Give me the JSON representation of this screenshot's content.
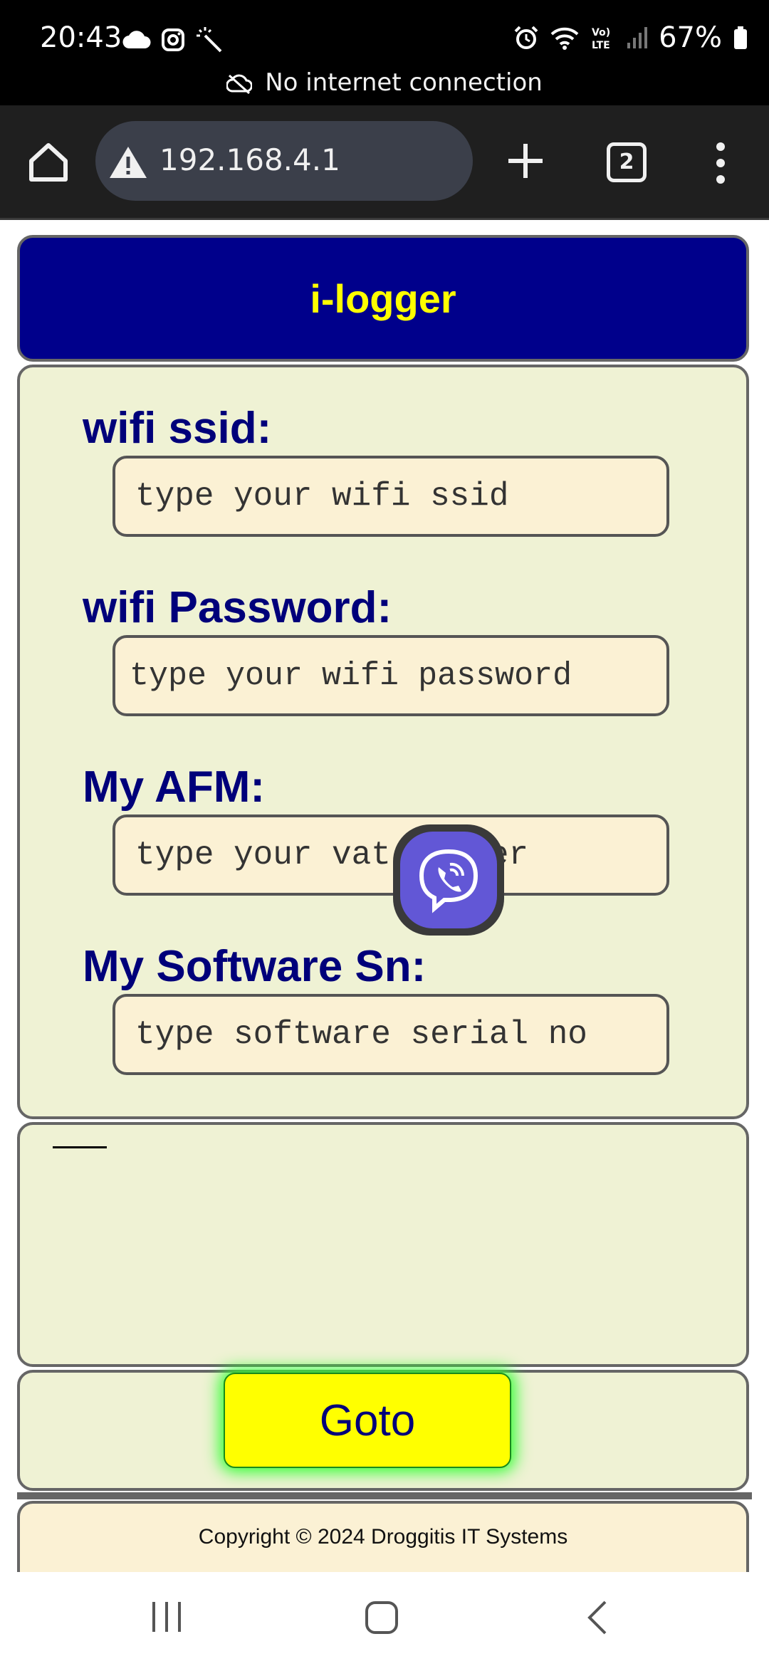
{
  "status_bar": {
    "time": "20:43",
    "battery": "67%",
    "connection_notice": "No internet connection",
    "icons": [
      "cloud-icon",
      "instagram-icon",
      "magic-wand-icon",
      "alarm-icon",
      "wifi-icon",
      "volte-icon",
      "signal-icon",
      "battery-icon"
    ]
  },
  "browser": {
    "url": "192.168.4.1",
    "tab_count": "2",
    "icons": [
      "home-icon",
      "warning-icon",
      "plus-icon",
      "tabs-icon",
      "more-vert-icon"
    ]
  },
  "page": {
    "title": "i-logger",
    "fields": [
      {
        "label": "wifi ssid:",
        "placeholder": "type your wifi ssid",
        "value": ""
      },
      {
        "label": "wifi Password:",
        "placeholder": "type your wifi password",
        "value": ""
      },
      {
        "label": "My AFM:",
        "placeholder": "type your vat number",
        "value": ""
      },
      {
        "label": "My Software Sn:",
        "placeholder": "type software serial no",
        "value": ""
      }
    ],
    "goto_label": "Goto",
    "footer": "Copyright © 2024 Droggitis IT Systems"
  },
  "overlay": {
    "icon": "viber-icon"
  },
  "nav_bar": {
    "icons": [
      "recents-icon",
      "home-nav-icon",
      "back-icon"
    ]
  },
  "colors": {
    "header_bg": "#00008b",
    "title_color": "#ffff00",
    "label_color": "#00007a",
    "panel_bg": "#eff2d4",
    "input_bg": "#fbf1d4",
    "button_bg": "#ffff00",
    "button_glow": "#33ff33",
    "viber": "#6257d6"
  }
}
